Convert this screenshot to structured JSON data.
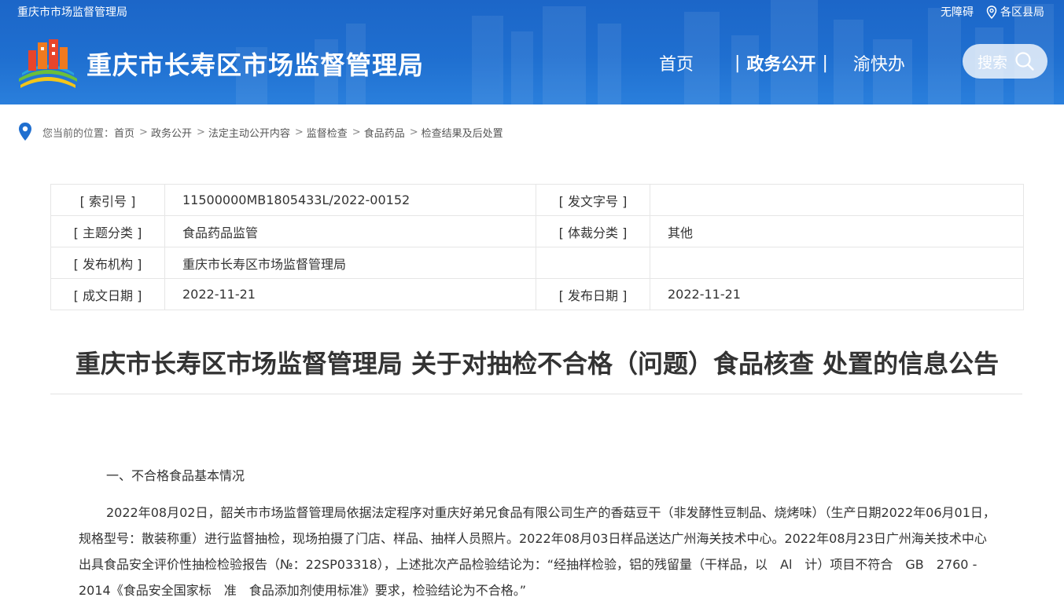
{
  "topbar": {
    "site_name": "重庆市市场监督管理局",
    "accessibility": "无障碍",
    "region_label": "各区县局"
  },
  "header": {
    "title": "重庆市长寿区市场监督管理局",
    "nav": {
      "home": "首页",
      "gov_affairs": "政务公开",
      "separator": "|",
      "yukuaiban": "渝快办"
    },
    "search_label": "搜索"
  },
  "breadcrumb": {
    "prefix": "您当前的位置：",
    "items": [
      "首页",
      "政务公开",
      "法定主动公开内容",
      "监督检查",
      "食品药品",
      "检查结果及后处置"
    ],
    "arrow": ">"
  },
  "meta": {
    "rows": [
      {
        "k1": "[ 索引号 ]",
        "v1": "11500000MB1805433L/2022-00152",
        "k2": "[ 发文字号 ]",
        "v2": ""
      },
      {
        "k1": "[ 主题分类 ]",
        "v1": "食品药品监管",
        "k2": "[ 体裁分类 ]",
        "v2": "其他"
      },
      {
        "k1": "[ 发布机构 ]",
        "v1": "重庆市长寿区市场监督管理局",
        "k2": "",
        "v2": ""
      },
      {
        "k1": "[ 成文日期 ]",
        "v1": "2022-11-21",
        "k2": "[ 发布日期 ]",
        "v2": "2022-11-21"
      }
    ]
  },
  "article": {
    "title": "重庆市长寿区市场监督管理局 关于对抽检不合格（问题）食品核查 处置的信息公告",
    "section1_heading": "一、不合格食品基本情况",
    "section1_para": "2022年08月02日，韶关市市场监督管理局依据法定程序对重庆好弟兄食品有限公司生产的香菇豆干（非发酵性豆制品、烧烤味）（生产日期2022年06月01日，规格型号：散装称重）进行监督抽检，现场拍摄了门店、样品、抽样人员照片。2022年08月03日样品送达广州海关技术中心。2022年08月23日广州海关技术中心出具食品安全评价性抽检检验报告（№：22SP03318），上述批次产品检验结论为：“经抽样检验，铝的残留量（干样品，以　Al　计）项目不符合　GB　2760 - 2014《食品安全国家标　准　食品添加剂使用标准》要求，检验结论为不合格。”"
  },
  "colors": {
    "header_blue": "#1f6fd0",
    "text": "#333333",
    "border": "#e6e6e6"
  }
}
